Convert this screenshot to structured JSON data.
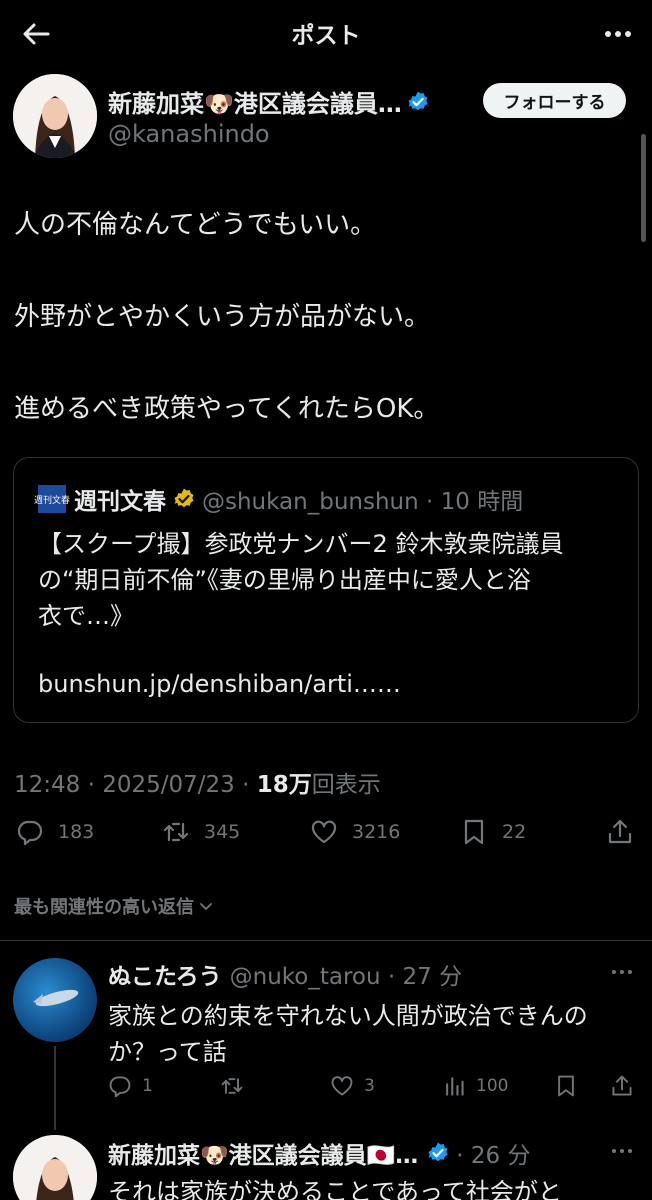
{
  "header": {
    "title": "ポスト"
  },
  "post": {
    "author_name": "新藤加菜🐶港区議会議員…",
    "author_handle": "@kanashindo",
    "follow_label": "フォローする",
    "lines": [
      "人の不倫なんてどうでもいい。",
      "外野がとやかくいう方が品がない。",
      "進めるべき政策やってくれたらOK。"
    ],
    "quote": {
      "logo_text": "週刊文春",
      "name": "週刊文春",
      "handle_time": "@shukan_bunshun · 10 時間",
      "lines": [
        "【スクープ撮】参政党ナンバー2 鈴木敦衆院議員",
        "の“期日前不倫”《妻の里帰り出産中に愛人と浴",
        "衣で…》",
        "bunshun.jp/denshiban/arti……"
      ]
    },
    "time_date": "12:48 · 2025/07/23 · ",
    "views_count": "18万",
    "views_label": "回表示",
    "stats": {
      "replies": "183",
      "reposts": "345",
      "likes": "3216",
      "bookmarks": "22"
    }
  },
  "relevant_label": "最も関連性の高い返信",
  "replies": [
    {
      "name": "ぬこたろう",
      "handle_time": "@nuko_tarou · 27 分",
      "lines": [
        "家族との約束を守れない人間が政治できんの",
        "か？って話"
      ],
      "stats": {
        "replies": "1",
        "reposts": "",
        "likes": "3",
        "views": "100"
      }
    },
    {
      "name": "新藤加菜🐶港区議会議員🇯🇵…",
      "handle_time": "· 26 分",
      "lines": [
        "それは家族が決めることであって社会がと"
      ]
    }
  ],
  "colors": {
    "background": "#000000",
    "text": "#e7e9ea",
    "muted": "#71767b",
    "verified": "#1d9bf0",
    "gold": "#e2b719"
  }
}
